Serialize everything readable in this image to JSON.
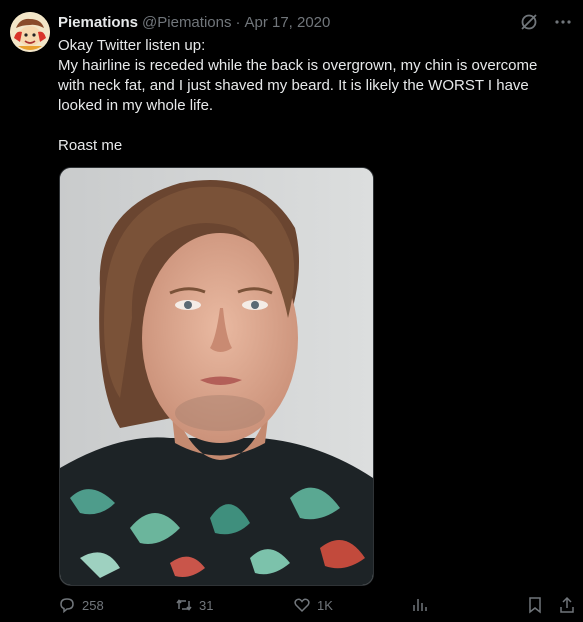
{
  "tweet": {
    "display_name": "Piemations",
    "handle": "@Piemations",
    "separator": "·",
    "date": "Apr 17, 2020",
    "lines": [
      "Okay Twitter listen up:",
      "My hairline is receded while the back is overgrown, my chin is overcome with neck fat, and I just shaved my beard. It is likely the WORST I have looked in my whole life.",
      "Roast me"
    ],
    "stats": {
      "replies": "258",
      "retweets": "31",
      "likes": "1K"
    }
  },
  "icons": {
    "top": [
      "grok-icon",
      "more-icon"
    ],
    "actions": [
      "reply-icon",
      "retweet-icon",
      "like-icon",
      "views-icon",
      "bookmark-icon",
      "share-icon"
    ]
  },
  "colors": {
    "background": "#000000",
    "text": "#e7e9ea",
    "muted": "#71767b"
  }
}
